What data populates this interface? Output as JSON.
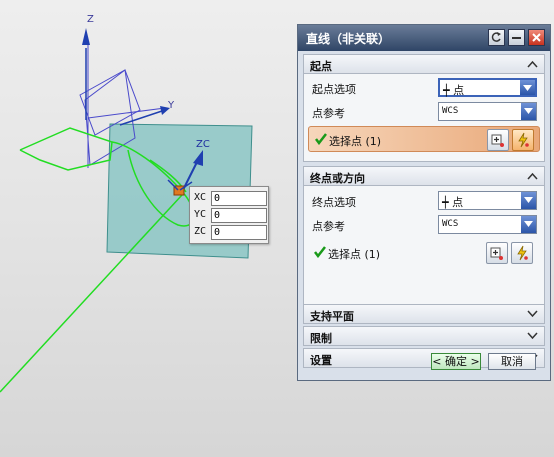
{
  "viewport": {
    "axes": {
      "y_label": "Y",
      "z_label": "Z",
      "zc_label": "ZC"
    },
    "coord_popup": [
      {
        "label": "XC",
        "value": "0"
      },
      {
        "label": "YC",
        "value": "0"
      },
      {
        "label": "ZC",
        "value": "0"
      }
    ]
  },
  "dialog": {
    "title": "直线（非关联）",
    "start": {
      "header": "起点",
      "option_label": "起点选项",
      "option_value": "┿ 点",
      "ref_label": "点参考",
      "ref_value": "WCS",
      "select_text": "选择点 (1)"
    },
    "end": {
      "header": "终点或方向",
      "option_label": "终点选项",
      "option_value": "┿ 点",
      "ref_label": "点参考",
      "ref_value": "WCS",
      "select_text": "选择点 (1)"
    },
    "collapsed": [
      {
        "label": "支持平面"
      },
      {
        "label": "限制"
      },
      {
        "label": "设置"
      }
    ],
    "ok_label": "< 确定 >",
    "cancel_label": "取消"
  },
  "colors": {
    "title_bar": "#2f4566",
    "plane_fill": "#7fc2c0",
    "green_curve": "#22dd22",
    "axis_blue": "#1f3fb0",
    "active_row": "#e9a878"
  }
}
